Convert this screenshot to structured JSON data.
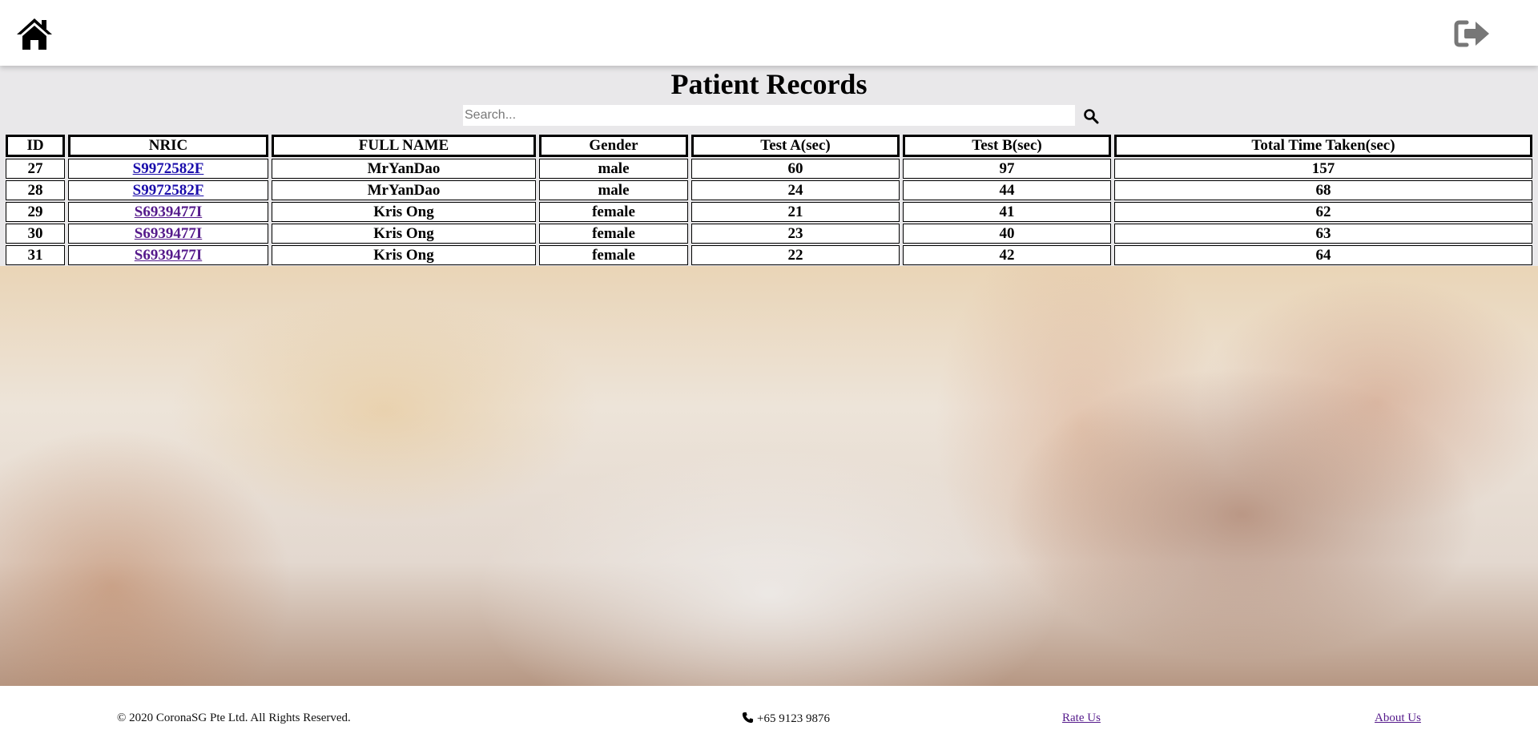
{
  "header": {
    "home_icon": "home-icon",
    "logout_icon": "sign-out-icon",
    "logout_icon_color": "#777777"
  },
  "main": {
    "title": "Patient Records",
    "search_placeholder": "Search...",
    "search_value": "",
    "search_icon": "search-icon",
    "panel_color": "#e9e8ea"
  },
  "table": {
    "headers": [
      "ID",
      "NRIC",
      "FULL NAME",
      "Gender",
      "Test A(sec)",
      "Test B(sec)",
      "Total Time Taken(sec)"
    ],
    "rows": [
      {
        "id": "27",
        "nric": "S9972582F",
        "full_name": "MrYanDao",
        "gender": "male",
        "test_a": "60",
        "test_b": "97",
        "total": "157"
      },
      {
        "id": "28",
        "nric": "S9972582F",
        "full_name": "MrYanDao",
        "gender": "male",
        "test_a": "24",
        "test_b": "44",
        "total": "68"
      },
      {
        "id": "29",
        "nric": "S6939477I",
        "full_name": "Kris Ong",
        "gender": "female",
        "test_a": "21",
        "test_b": "41",
        "total": "62"
      },
      {
        "id": "30",
        "nric": "S6939477I",
        "full_name": "Kris Ong",
        "gender": "female",
        "test_a": "23",
        "test_b": "40",
        "total": "63"
      },
      {
        "id": "31",
        "nric": "S6939477I",
        "full_name": "Kris Ong",
        "gender": "female",
        "test_a": "22",
        "test_b": "42",
        "total": "64"
      }
    ]
  },
  "footer": {
    "copyright": "© 2020 CoronaSG Pte Ltd. All Rights Reserved.",
    "phone_icon": "phone-icon",
    "phone": "+65 9123 9876",
    "rate_us": "Rate Us",
    "about_us": "About Us",
    "link_color": "#551a8b"
  }
}
